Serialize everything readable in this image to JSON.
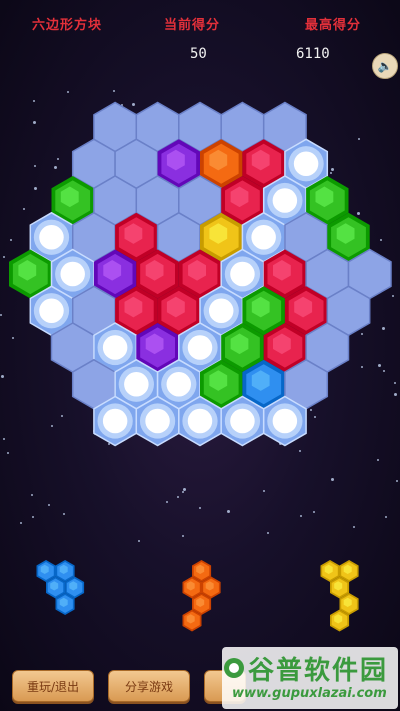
{
  "header": {
    "title_label": "六边形方块",
    "score_label": "当前得分",
    "score_value": "50",
    "best_label": "最高得分",
    "best_value": "6110"
  },
  "sound_icon": "speaker-icon",
  "colors": {
    "empty": "#8da4e6",
    "purple": "#8a2fe0",
    "orange": "#f46a12",
    "red": "#e8234e",
    "green": "#34c223",
    "yellow": "#f0c418",
    "blue": "#2f8ff0",
    "glow": "#ffffff"
  },
  "board": {
    "rows": [
      [
        "empty",
        "empty",
        "empty",
        "empty",
        "empty"
      ],
      [
        "empty",
        "empty",
        "purple",
        "orange",
        "red",
        "glow"
      ],
      [
        "green",
        "empty",
        "empty",
        "empty",
        "red",
        "glow",
        "green"
      ],
      [
        "glow",
        "empty",
        "red",
        "empty",
        "yellow",
        "glow",
        "empty",
        "green"
      ],
      [
        "green",
        "glow",
        "purple",
        "red",
        "red",
        "glow",
        "red",
        "empty",
        "empty"
      ],
      [
        "glow",
        "empty",
        "red",
        "red",
        "glow",
        "green",
        "red",
        "empty"
      ],
      [
        "empty",
        "glow",
        "purple",
        "glow",
        "green",
        "red",
        "empty"
      ],
      [
        "empty",
        "glow",
        "glow",
        "green",
        "blue",
        "empty"
      ],
      [
        "glow",
        "glow",
        "glow",
        "glow",
        "glow"
      ]
    ]
  },
  "pieces": [
    {
      "color": "blue",
      "cells": [
        [
          0,
          0
        ],
        [
          1,
          0
        ],
        [
          0.5,
          1
        ],
        [
          1.5,
          1
        ],
        [
          1,
          2
        ]
      ]
    },
    {
      "color": "orange",
      "cells": [
        [
          0.5,
          0
        ],
        [
          0,
          1
        ],
        [
          1,
          1
        ],
        [
          0.5,
          2
        ],
        [
          0,
          3
        ]
      ]
    },
    {
      "color": "yellow",
      "cells": [
        [
          0,
          0
        ],
        [
          1,
          0
        ],
        [
          0.5,
          1
        ],
        [
          1,
          2
        ],
        [
          0.5,
          3
        ]
      ]
    }
  ],
  "buttons": {
    "replay_exit": "重玩/退出",
    "share": "分享游戏"
  },
  "watermark": {
    "title": "谷普软件园",
    "url": "www.gupuxlazai.com"
  }
}
